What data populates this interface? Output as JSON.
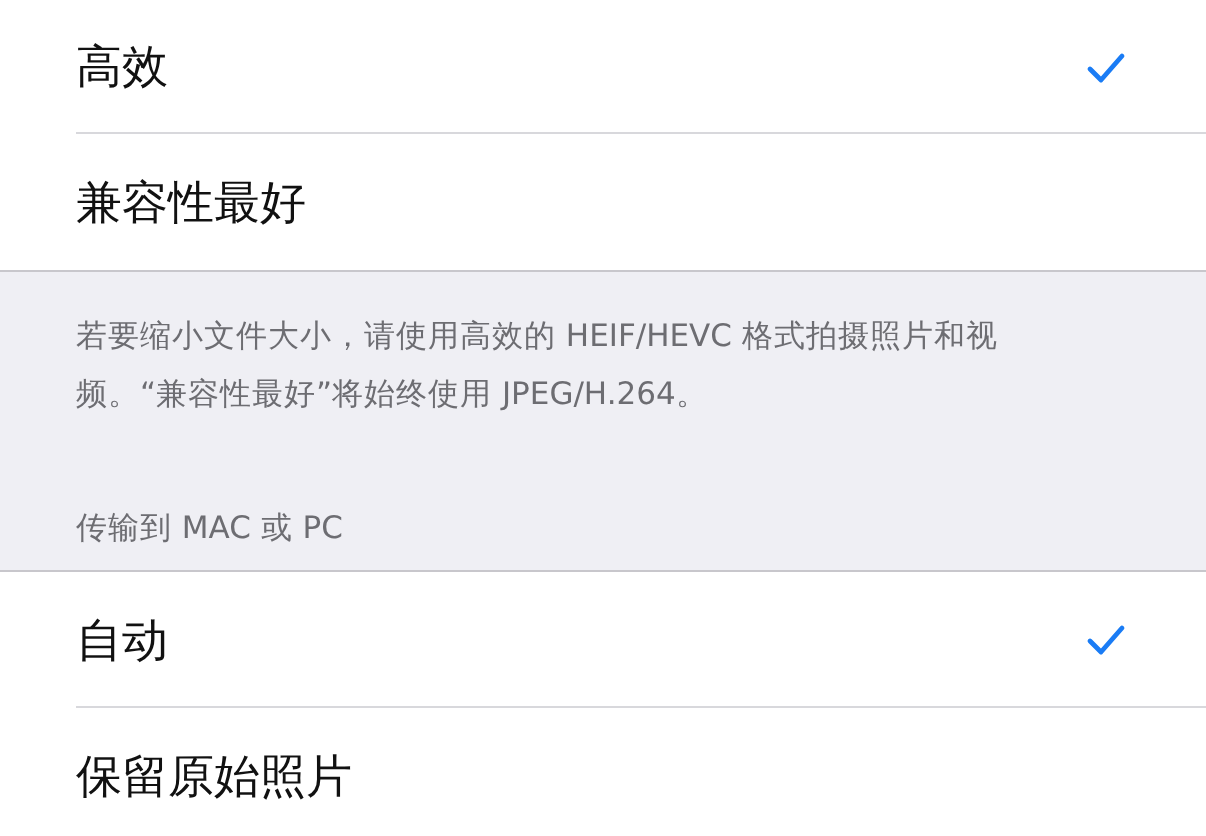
{
  "groups": [
    {
      "items": [
        {
          "label": "高效",
          "selected": true
        },
        {
          "label": "兼容性最好",
          "selected": false
        }
      ],
      "footer": "若要缩小文件大小，请使用高效的 HEIF/HEVC 格式拍摄照片和视频。“兼容性最好”将始终使用 JPEG/H.264。"
    },
    {
      "header": "传输到 MAC 或 PC",
      "items": [
        {
          "label": "自动",
          "selected": true
        },
        {
          "label": "保留原始照片",
          "selected": false
        }
      ]
    }
  ]
}
